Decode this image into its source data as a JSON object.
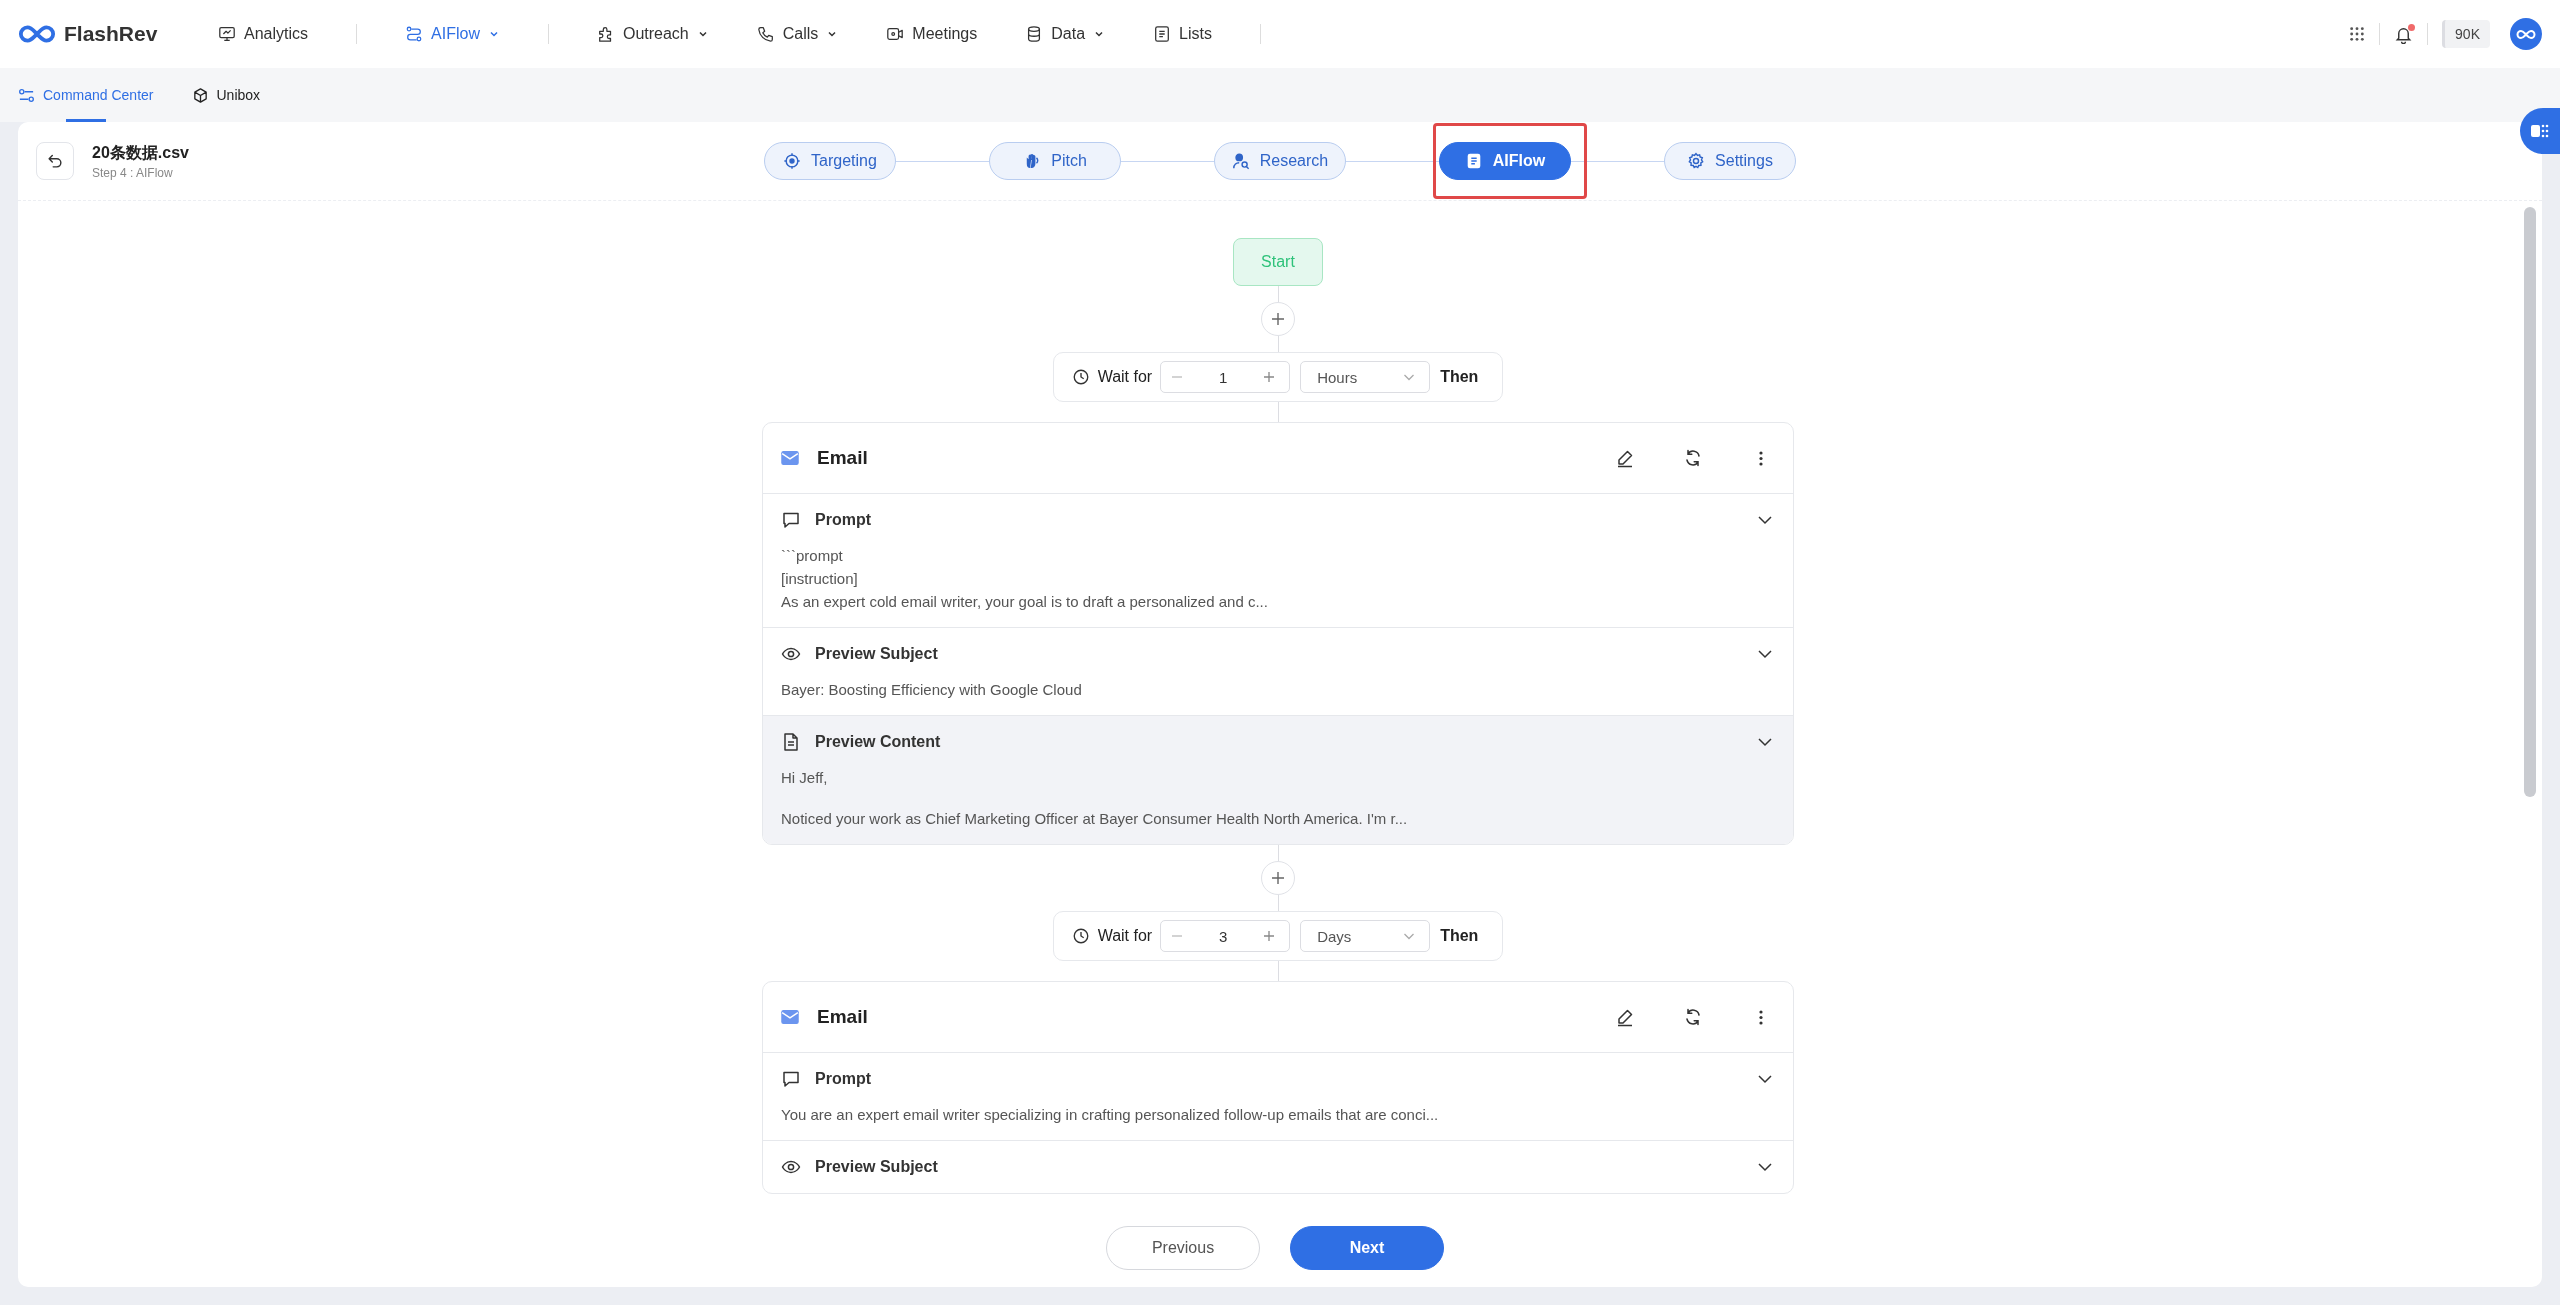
{
  "brand": {
    "name": "FlashRev"
  },
  "nav_groups": [
    [
      {
        "label": "Analytics",
        "dropdown": false,
        "selected": false
      }
    ],
    [
      {
        "label": "AIFlow",
        "dropdown": true,
        "selected": true
      }
    ],
    [
      {
        "label": "Outreach",
        "dropdown": true,
        "selected": false
      },
      {
        "label": "Calls",
        "dropdown": true,
        "selected": false
      },
      {
        "label": "Meetings",
        "dropdown": false,
        "selected": false
      },
      {
        "label": "Data",
        "dropdown": true,
        "selected": false
      },
      {
        "label": "Lists",
        "dropdown": false,
        "selected": false
      }
    ]
  ],
  "top_right": {
    "notification_dot": true,
    "credits": "90K"
  },
  "subnav": [
    {
      "label": "Command Center",
      "selected": true
    },
    {
      "label": "Unibox",
      "selected": false
    }
  ],
  "file": {
    "title": "20条数据.csv",
    "step": "Step 4 : AIFlow"
  },
  "steps": [
    {
      "label": "Targeting",
      "selected": false,
      "highlighted": false
    },
    {
      "label": "Pitch",
      "selected": false,
      "highlighted": false
    },
    {
      "label": "Research",
      "selected": false,
      "highlighted": false
    },
    {
      "label": "AIFlow",
      "selected": true,
      "highlighted": true
    },
    {
      "label": "Settings",
      "selected": false,
      "highlighted": false
    }
  ],
  "flow": {
    "start": "Start",
    "items": [
      {
        "kind": "wait",
        "label": "Wait for",
        "value": "1",
        "unit": "Hours",
        "then": "Then"
      },
      {
        "kind": "email",
        "title": "Email",
        "sections": [
          {
            "title": "Prompt",
            "shaded": false,
            "paragraphs": [
              [
                "```prompt",
                "[instruction]",
                "As an expert cold email writer, your goal is to draft a personalized and c..."
              ]
            ]
          },
          {
            "title": "Preview Subject",
            "shaded": false,
            "paragraphs": [
              [
                "Bayer: Boosting Efficiency with Google Cloud"
              ]
            ]
          },
          {
            "title": "Preview Content",
            "shaded": true,
            "paragraphs": [
              [
                "Hi Jeff,"
              ],
              [
                "Noticed your work as Chief Marketing Officer at Bayer Consumer Health North America. I'm r..."
              ]
            ]
          }
        ]
      },
      {
        "kind": "wait",
        "label": "Wait for",
        "value": "3",
        "unit": "Days",
        "then": "Then"
      },
      {
        "kind": "email",
        "title": "Email",
        "sections": [
          {
            "title": "Prompt",
            "shaded": false,
            "paragraphs": [
              [
                "You are an expert email writer specializing in crafting personalized follow-up emails that are conci..."
              ]
            ]
          },
          {
            "title": "Preview Subject",
            "shaded": false
          }
        ]
      }
    ]
  },
  "footer": [
    {
      "label": "Previous",
      "kind": "secondary"
    },
    {
      "label": "Next",
      "kind": "primary"
    }
  ]
}
